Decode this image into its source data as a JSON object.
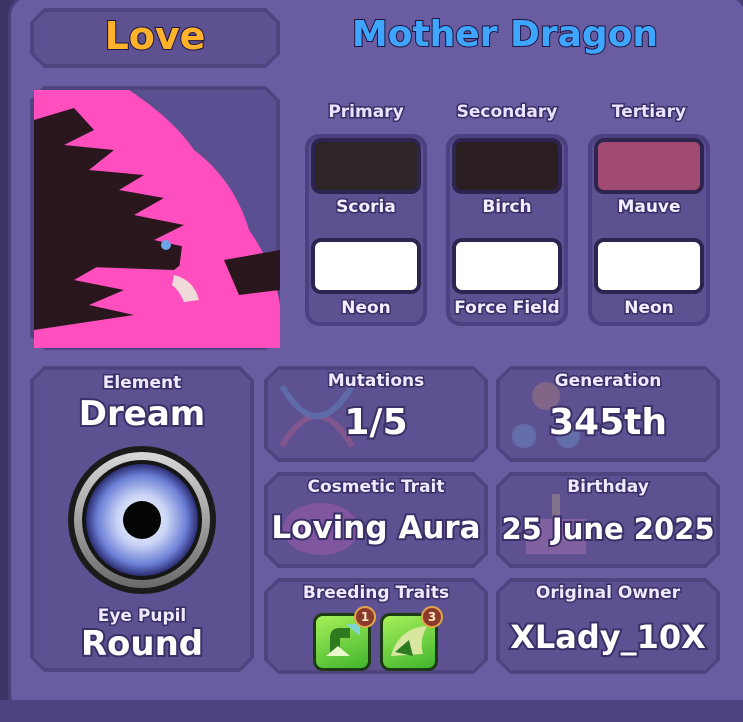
{
  "header": {
    "category": "Love",
    "name": "Mother Dragon"
  },
  "colors": {
    "headers": {
      "primary": "Primary",
      "secondary": "Secondary",
      "tertiary": "Tertiary"
    },
    "primary": {
      "swatch": "#2e2526",
      "name": "Scoria",
      "glow_swatch": "#ffffff",
      "glow_name": "Neon"
    },
    "secondary": {
      "swatch": "#2a1e20",
      "name": "Birch",
      "glow_swatch": "#ffffff",
      "glow_name": "Force Field"
    },
    "tertiary": {
      "swatch": "#a14b72",
      "name": "Mauve",
      "glow_swatch": "#ffffff",
      "glow_name": "Neon"
    }
  },
  "stats": {
    "element_label": "Element",
    "element_value": "Dream",
    "eye_label": "Eye Pupil",
    "eye_value": "Round",
    "mutations_label": "Mutations",
    "mutations_value": "1/5",
    "generation_label": "Generation",
    "generation_value": "345th",
    "cosmetic_label": "Cosmetic Trait",
    "cosmetic_value": "Loving Aura",
    "birthday_label": "Birthday",
    "birthday_value": "25 June 2025",
    "breeding_label": "Breeding Traits",
    "owner_label": "Original Owner",
    "owner_value": "XLady_10X"
  },
  "breeding_traits": [
    {
      "icon": "green-claw-icon",
      "level": "1"
    },
    {
      "icon": "green-wing-icon",
      "level": "3"
    }
  ],
  "accent": {
    "title_orange": "#ffb22a",
    "title_blue": "#3fa6ff",
    "panel": "#5d5191"
  }
}
